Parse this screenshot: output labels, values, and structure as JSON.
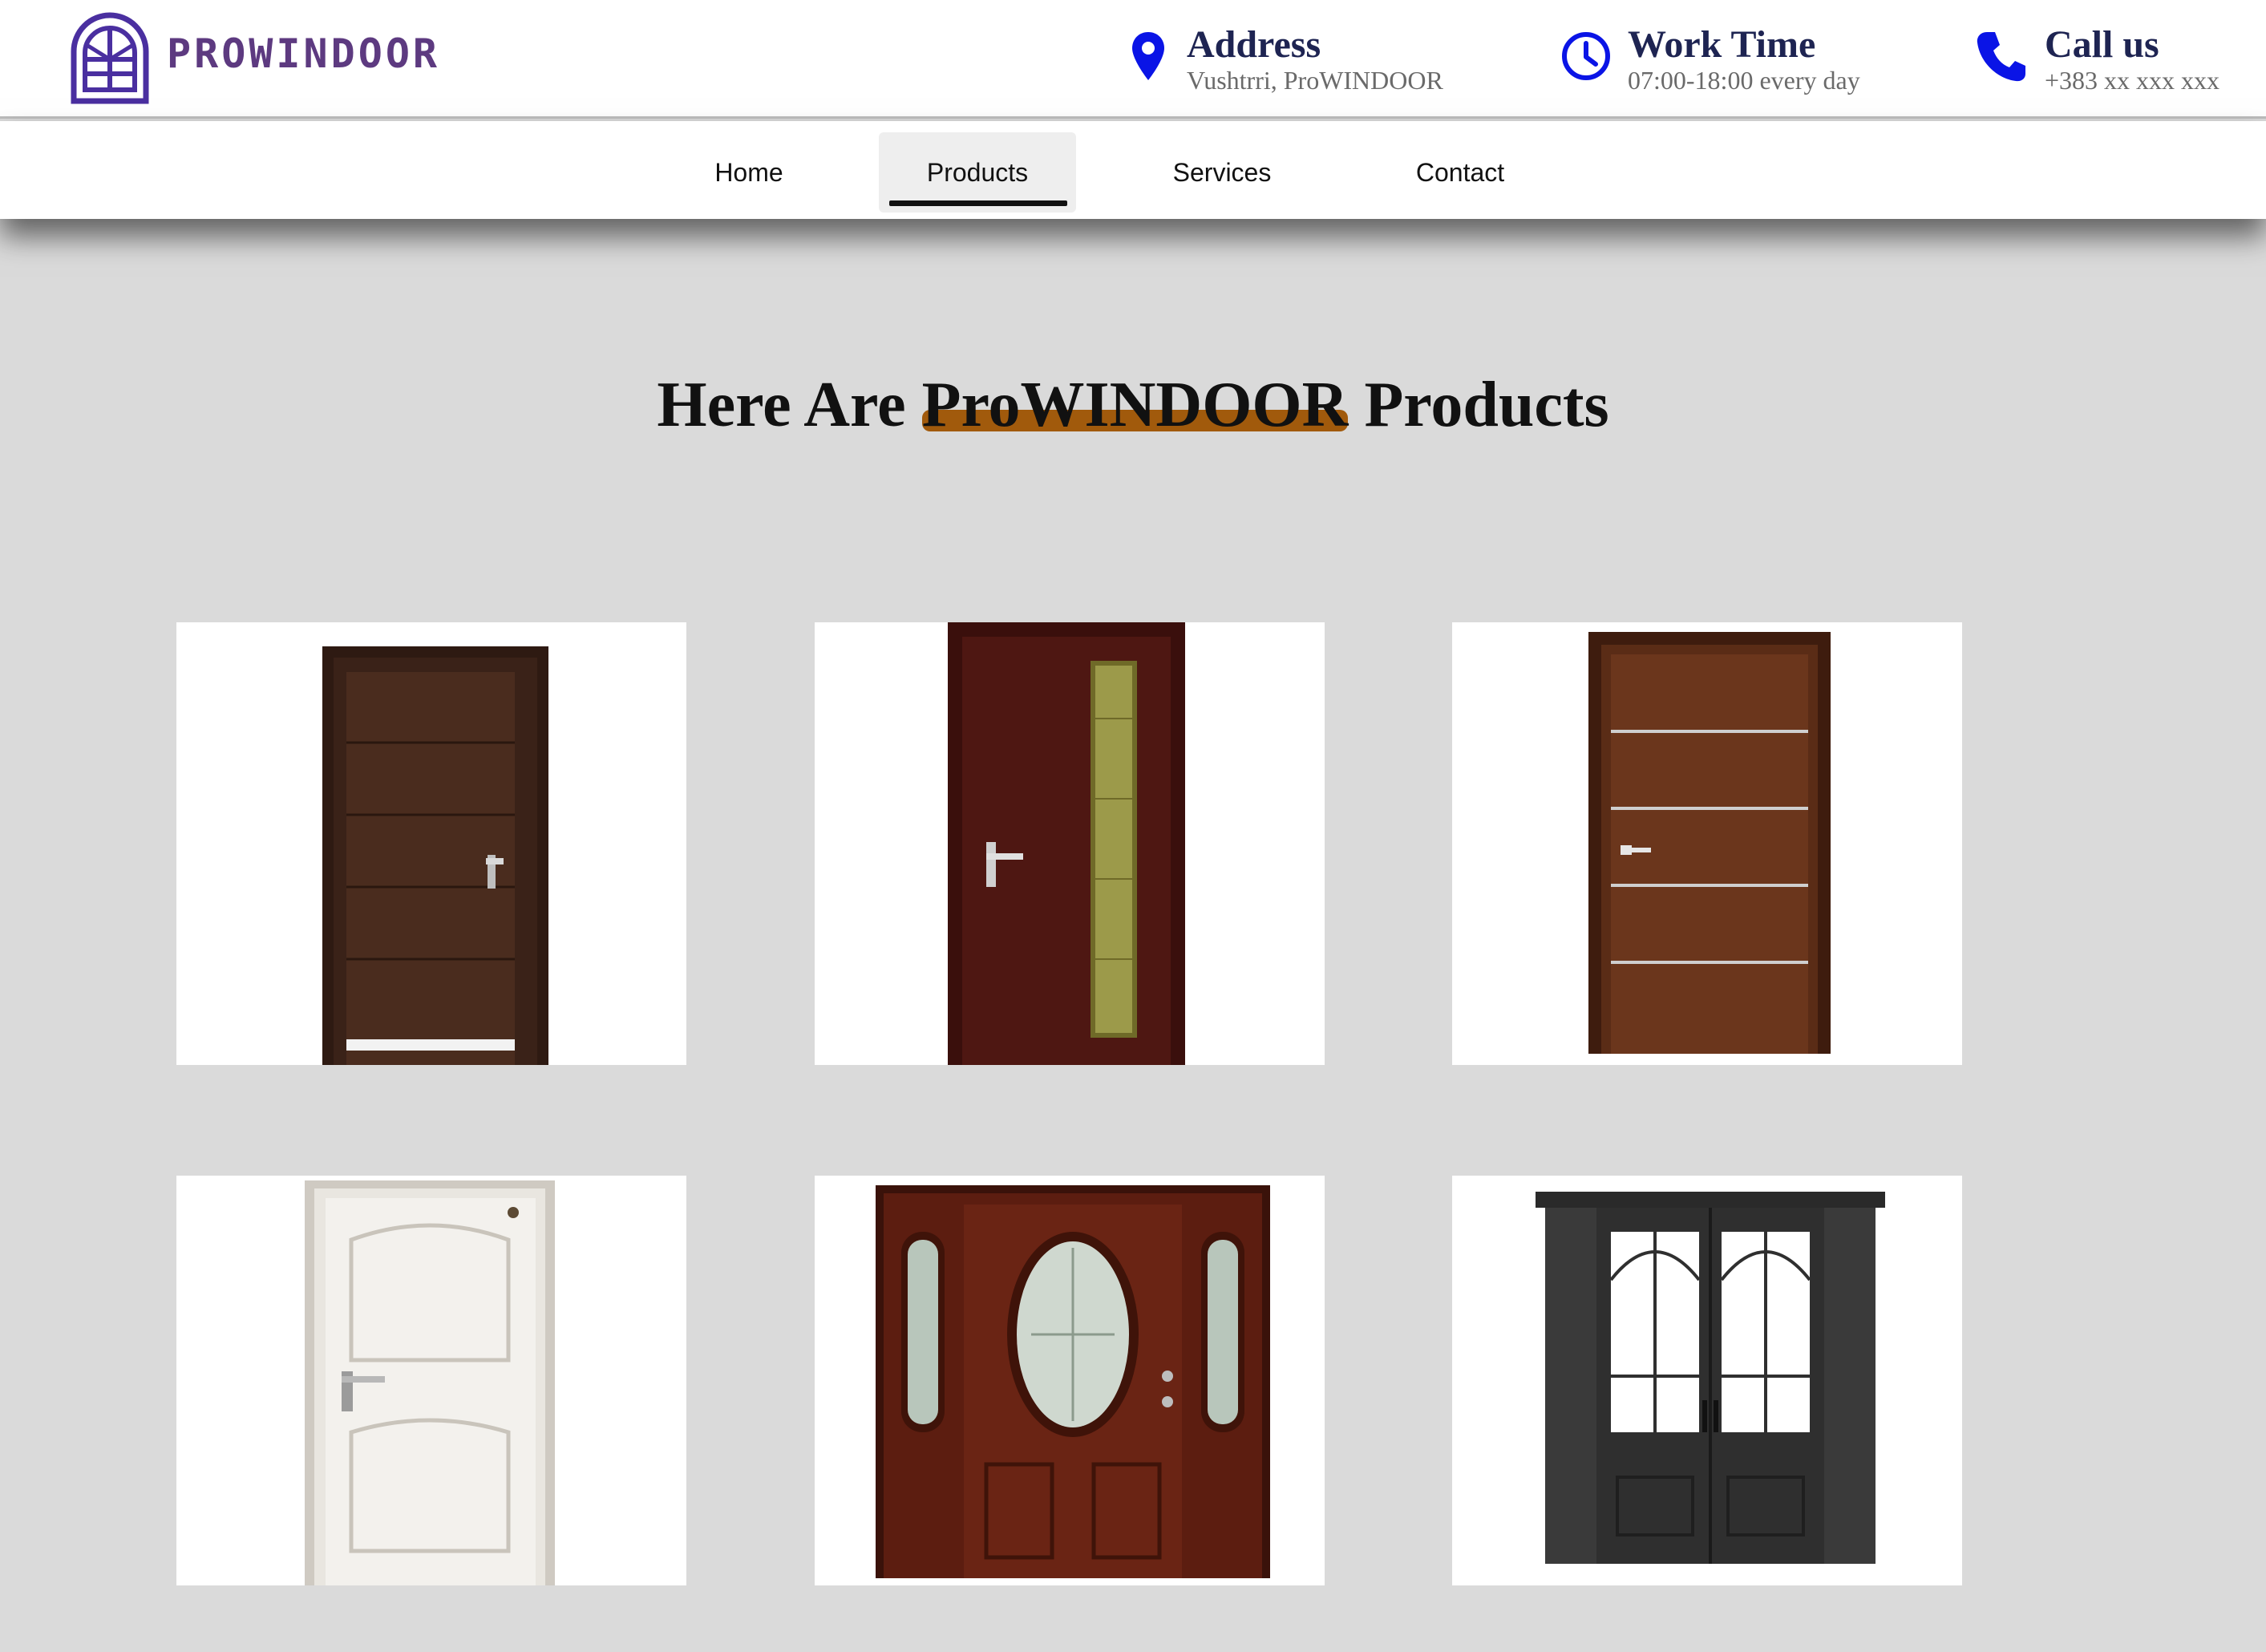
{
  "brand": {
    "name": "PROWINDOOR",
    "logo_icon": "arched-window-icon",
    "color": "#5d3a80"
  },
  "header_info": {
    "address": {
      "icon": "map-pin-icon",
      "title": "Address",
      "detail": "Vushtrri, ProWINDOOR"
    },
    "work_time": {
      "icon": "clock-icon",
      "title": "Work Time",
      "detail": "07:00-18:00 every day"
    },
    "call": {
      "icon": "phone-icon",
      "title": "Call us",
      "detail": "+383 xx xxx xxx"
    },
    "accent_color": "#0a14e6"
  },
  "nav": {
    "items": [
      {
        "label": "Home"
      },
      {
        "label": "Products",
        "active": true
      },
      {
        "label": "Services"
      },
      {
        "label": "Contact"
      }
    ]
  },
  "heading": {
    "before": "Here Are ",
    "highlight": "ProWINDOOR",
    "after": " Products",
    "highlight_color": "#a15a0c"
  },
  "products": [
    {
      "image": "dark-brown-door-with-horizontal-grooves"
    },
    {
      "image": "mahogany-door-with-vertical-glass-strip"
    },
    {
      "image": "walnut-door-with-silver-lines"
    },
    {
      "image": "white-paneled-door"
    },
    {
      "image": "mahogany-entry-door-with-oval-glass-and-sidelights"
    },
    {
      "image": "black-double-door-with-arched-glass"
    }
  ]
}
